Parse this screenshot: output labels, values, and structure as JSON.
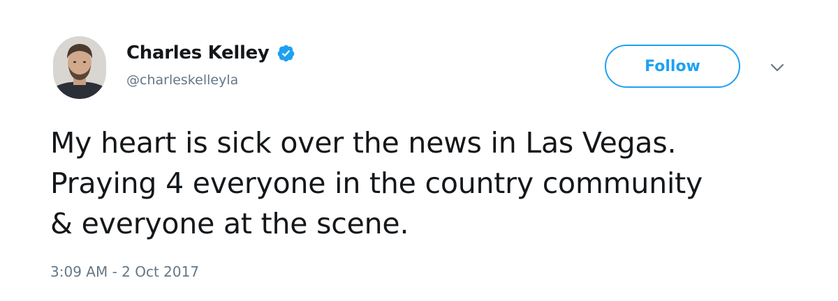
{
  "user": {
    "display_name": "Charles Kelley",
    "handle": "@charleskelleyla",
    "verified": true,
    "avatar_icon": "avatar-photo",
    "verified_icon": "verified-badge-icon"
  },
  "actions": {
    "follow_label": "Follow",
    "menu_icon": "chevron-down-icon"
  },
  "tweet": {
    "lines": [
      "My heart is sick over the news in Las Vegas.",
      "Praying 4 everyone in the country community",
      "& everyone at the scene."
    ],
    "timestamp": "3:09 AM - 2 Oct 2017"
  },
  "colors": {
    "accent": "#1da1f2",
    "text_primary": "#14171a",
    "text_secondary": "#657786",
    "background": "#ffffff"
  }
}
